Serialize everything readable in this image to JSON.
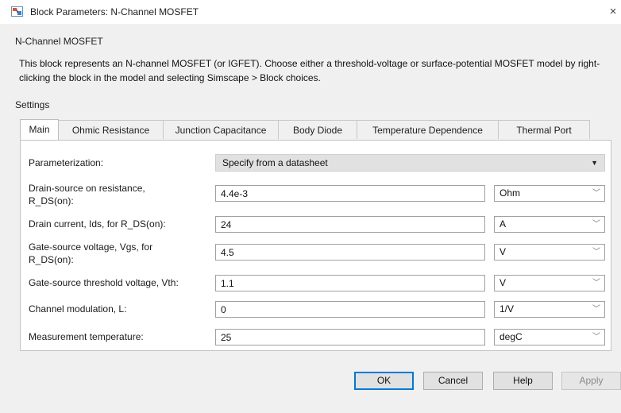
{
  "window": {
    "title": "Block Parameters: N-Channel MOSFET",
    "close_glyph": "×"
  },
  "block": {
    "name": "N-Channel MOSFET",
    "description": "This block represents an N-channel MOSFET (or IGFET). Choose either a threshold-voltage or surface-potential MOSFET model by right-clicking the block in the model and selecting Simscape > Block choices."
  },
  "settings": {
    "label": "Settings",
    "tabs": [
      {
        "label": "Main"
      },
      {
        "label": "Ohmic Resistance"
      },
      {
        "label": "Junction Capacitance"
      },
      {
        "label": "Body Diode"
      },
      {
        "label": "Temperature Dependence"
      },
      {
        "label": "Thermal Port"
      }
    ]
  },
  "parameterization": {
    "label": "Parameterization:",
    "selected": "Specify from a datasheet"
  },
  "params": [
    {
      "label": "Drain-source on resistance, R_DS(on):",
      "value": "4.4e-3",
      "unit": "Ohm"
    },
    {
      "label": "Drain current, Ids, for R_DS(on):",
      "value": "24",
      "unit": "A"
    },
    {
      "label": "Gate-source voltage, Vgs, for R_DS(on):",
      "value": "4.5",
      "unit": "V"
    },
    {
      "label": "Gate-source threshold voltage, Vth:",
      "value": "1.1",
      "unit": "V"
    },
    {
      "label": "Channel modulation, L:",
      "value": "0",
      "unit": "1/V"
    },
    {
      "label": "Measurement temperature:",
      "value": "25",
      "unit": "degC"
    }
  ],
  "buttons": {
    "ok": "OK",
    "cancel": "Cancel",
    "help": "Help",
    "apply": "Apply"
  },
  "icons": {
    "app": "simulink-block-icon",
    "close": "close-icon",
    "dropdown": "chevron-down-icon",
    "caret": "caret-down-icon"
  }
}
